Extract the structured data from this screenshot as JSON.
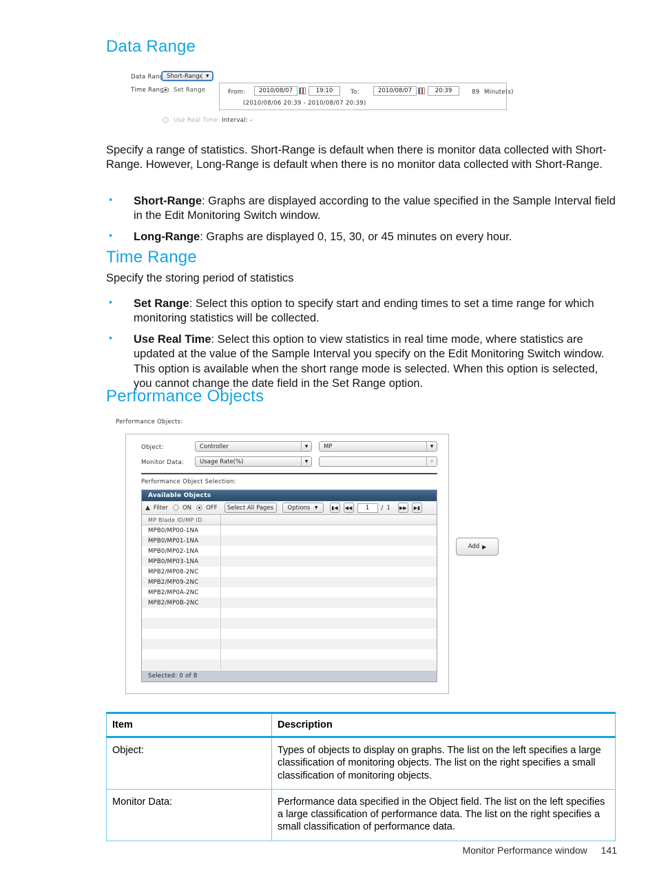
{
  "sections": {
    "data_range": {
      "heading": "Data Range",
      "body": "Specify a range of statistics. Short-Range is default when there is monitor data collected with Short-Range. However, Long-Range is default when there is no monitor data collected with Short-Range.",
      "bullets": [
        {
          "term": "Short-Range",
          "text": ": Graphs are displayed according to the value specified in the Sample Interval field in the Edit Monitoring Switch window."
        },
        {
          "term": "Long-Range",
          "text": ": Graphs are displayed 0, 15, 30, or 45 minutes on every hour."
        }
      ]
    },
    "time_range": {
      "heading": "Time Range",
      "body": "Specify the storing period of statistics",
      "bullets": [
        {
          "term": "Set Range",
          "text": ": Select this option to specify start and ending times to set a time range for which monitoring statistics will be collected."
        },
        {
          "term": "Use Real Time",
          "text": ": Select this option to view statistics in real time mode, where statistics are updated at the value of the Sample Interval you specify on the Edit Monitoring Switch window. This option is available when the short range mode is selected. When this option is selected, you cannot change the date field in the Set Range option."
        }
      ]
    },
    "performance_objects": {
      "heading": "Performance Objects"
    }
  },
  "figure_data_range": {
    "data_range_label": "Data Range:",
    "data_range_value": "Short-Range",
    "time_range_label": "Time Range:",
    "set_range_label": "Set Range",
    "use_real_time_label": "Use Real Time",
    "from_label": "From:",
    "from_date": "2010/08/07",
    "from_time": "19:10",
    "to_label": "To:",
    "to_date": "2010/08/07",
    "to_time": "20:39",
    "duration_value": "89",
    "duration_unit": "Minute(s)",
    "range_note": "(2010/08/06 20:39 - 2010/08/07 20:39)",
    "interval_label": "Interval: -"
  },
  "figure_perf_objects": {
    "caption": "Performance Objects:",
    "object_label": "Object:",
    "object_left_value": "Controller",
    "object_right_value": "MP",
    "monitor_data_label": "Monitor Data:",
    "monitor_data_left_value": "Usage Rate(%)",
    "monitor_data_right_value": "",
    "selection_label": "Performance Object Selection:",
    "grid_title": "Available Objects",
    "filter_label": "Filter",
    "filter_on_label": "ON",
    "filter_off_label": "OFF",
    "select_all_pages_label": "Select All Pages",
    "options_label": "Options",
    "page_current": "1",
    "page_separator": "/",
    "page_total": "1",
    "column_header": "MP Blade ID/MP ID",
    "rows": [
      "MPB0/MP00-1NA",
      "MPB0/MP01-1NA",
      "MPB0/MP02-1NA",
      "MPB0/MP03-1NA",
      "MPB2/MP08-2NC",
      "MPB2/MP09-2NC",
      "MPB2/MP0A-2NC",
      "MPB2/MP0B-2NC"
    ],
    "empty_row_count": 6,
    "status_text": "Selected:  0    of  8",
    "add_button_label": "Add"
  },
  "desc_table": {
    "headers": [
      "Item",
      "Description"
    ],
    "rows": [
      {
        "item": "Object:",
        "description": "Types of objects to display on graphs. The list on the left specifies a large classification of monitoring objects. The list on the right specifies a small classification of monitoring objects."
      },
      {
        "item": "Monitor Data:",
        "description": "Performance data specified in the Object field. The list on the left specifies a large classification of performance data. The list on the right specifies a small classification of performance data."
      }
    ]
  },
  "footer": {
    "title": "Monitor Performance window",
    "page_number": "141"
  },
  "colors": {
    "heading": "#15a5e0",
    "bullet": "#2ba6e0",
    "table_border": "#57c2ee",
    "grid_header": "#335778"
  }
}
